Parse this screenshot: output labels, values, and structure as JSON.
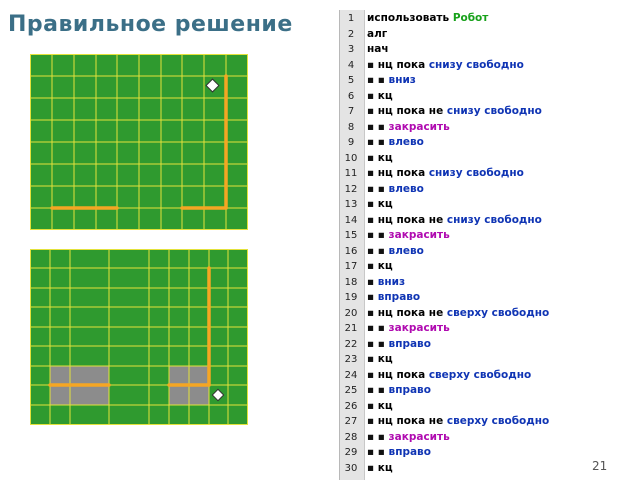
{
  "slide": {
    "title": "Правильное решение",
    "page_number": "21"
  },
  "colors": {
    "field_green": "#2f9a2f",
    "grid_yellow": "#e3e23b",
    "wall_orange": "#f5a623",
    "painted_gray": "#8c8c8c",
    "keyword_blue": "#0f34b4",
    "robot_green": "#17a11a",
    "paint_magenta": "#b00ab0"
  },
  "icons": {
    "robot": "diamond-robot-icon"
  },
  "code": {
    "lines": [
      {
        "n": "1",
        "parts": [
          {
            "t": "использовать ",
            "c": "t-kw"
          },
          {
            "t": "Робот",
            "c": "t-robot"
          }
        ]
      },
      {
        "n": "2",
        "parts": [
          {
            "t": "алг",
            "c": "t-kw"
          }
        ]
      },
      {
        "n": "3",
        "parts": [
          {
            "t": "нач",
            "c": "t-kw"
          }
        ]
      },
      {
        "n": "4",
        "parts": [
          {
            "t": "▪ ",
            "c": "bul"
          },
          {
            "t": "нц пока ",
            "c": "t-kw"
          },
          {
            "t": "снизу свободно",
            "c": "t-cmd"
          }
        ]
      },
      {
        "n": "5",
        "parts": [
          {
            "t": "▪ ▪ ",
            "c": "bul"
          },
          {
            "t": "вниз",
            "c": "t-cmd"
          }
        ]
      },
      {
        "n": "6",
        "parts": [
          {
            "t": "▪ ",
            "c": "bul"
          },
          {
            "t": "кц",
            "c": "t-kw"
          }
        ]
      },
      {
        "n": "7",
        "parts": [
          {
            "t": "▪ ",
            "c": "bul"
          },
          {
            "t": "нц пока не ",
            "c": "t-kw"
          },
          {
            "t": "снизу свободно",
            "c": "t-cmd"
          }
        ]
      },
      {
        "n": "8",
        "parts": [
          {
            "t": "▪ ▪ ",
            "c": "bul"
          },
          {
            "t": "закрасить",
            "c": "t-paint"
          }
        ]
      },
      {
        "n": "9",
        "parts": [
          {
            "t": "▪ ▪ ",
            "c": "bul"
          },
          {
            "t": "влево",
            "c": "t-cmd"
          }
        ]
      },
      {
        "n": "10",
        "parts": [
          {
            "t": "▪ ",
            "c": "bul"
          },
          {
            "t": "кц",
            "c": "t-kw"
          }
        ]
      },
      {
        "n": "11",
        "parts": [
          {
            "t": "▪ ",
            "c": "bul"
          },
          {
            "t": "нц пока ",
            "c": "t-kw"
          },
          {
            "t": "снизу свободно",
            "c": "t-cmd"
          }
        ]
      },
      {
        "n": "12",
        "parts": [
          {
            "t": "▪ ▪ ",
            "c": "bul"
          },
          {
            "t": "влево",
            "c": "t-cmd"
          }
        ]
      },
      {
        "n": "13",
        "parts": [
          {
            "t": "▪ ",
            "c": "bul"
          },
          {
            "t": "кц",
            "c": "t-kw"
          }
        ]
      },
      {
        "n": "14",
        "parts": [
          {
            "t": "▪ ",
            "c": "bul"
          },
          {
            "t": "нц пока не ",
            "c": "t-kw"
          },
          {
            "t": "снизу свободно",
            "c": "t-cmd"
          }
        ]
      },
      {
        "n": "15",
        "parts": [
          {
            "t": "▪ ▪ ",
            "c": "bul"
          },
          {
            "t": "закрасить",
            "c": "t-paint"
          }
        ]
      },
      {
        "n": "16",
        "parts": [
          {
            "t": "▪ ▪ ",
            "c": "bul"
          },
          {
            "t": "влево",
            "c": "t-cmd"
          }
        ]
      },
      {
        "n": "17",
        "parts": [
          {
            "t": "▪ ",
            "c": "bul"
          },
          {
            "t": "кц",
            "c": "t-kw"
          }
        ]
      },
      {
        "n": "18",
        "parts": [
          {
            "t": "▪ ",
            "c": "bul"
          },
          {
            "t": "вниз",
            "c": "t-cmd"
          }
        ]
      },
      {
        "n": "19",
        "parts": [
          {
            "t": "▪ ",
            "c": "bul"
          },
          {
            "t": "вправо",
            "c": "t-cmd"
          }
        ]
      },
      {
        "n": "20",
        "parts": [
          {
            "t": "▪ ",
            "c": "bul"
          },
          {
            "t": "нц пока не ",
            "c": "t-kw"
          },
          {
            "t": "сверху свободно",
            "c": "t-cmd"
          }
        ]
      },
      {
        "n": "21",
        "parts": [
          {
            "t": "▪ ▪ ",
            "c": "bul"
          },
          {
            "t": "закрасить",
            "c": "t-paint"
          }
        ]
      },
      {
        "n": "22",
        "parts": [
          {
            "t": "▪ ▪ ",
            "c": "bul"
          },
          {
            "t": "вправо",
            "c": "t-cmd"
          }
        ]
      },
      {
        "n": "23",
        "parts": [
          {
            "t": "▪ ",
            "c": "bul"
          },
          {
            "t": "кц",
            "c": "t-kw"
          }
        ]
      },
      {
        "n": "24",
        "parts": [
          {
            "t": "▪ ",
            "c": "bul"
          },
          {
            "t": "нц пока ",
            "c": "t-kw"
          },
          {
            "t": "сверху свободно",
            "c": "t-cmd"
          }
        ]
      },
      {
        "n": "25",
        "parts": [
          {
            "t": "▪ ▪ ",
            "c": "bul"
          },
          {
            "t": "вправо",
            "c": "t-cmd"
          }
        ]
      },
      {
        "n": "26",
        "parts": [
          {
            "t": "▪ ",
            "c": "bul"
          },
          {
            "t": "кц",
            "c": "t-kw"
          }
        ]
      },
      {
        "n": "27",
        "parts": [
          {
            "t": "▪ ",
            "c": "bul"
          },
          {
            "t": "нц пока не ",
            "c": "t-kw"
          },
          {
            "t": "сверху свободно",
            "c": "t-cmd"
          }
        ]
      },
      {
        "n": "28",
        "parts": [
          {
            "t": "▪ ▪ ",
            "c": "bul"
          },
          {
            "t": "закрасить",
            "c": "t-paint"
          }
        ]
      },
      {
        "n": "29",
        "parts": [
          {
            "t": "▪ ▪ ",
            "c": "bul"
          },
          {
            "t": "вправо",
            "c": "t-cmd"
          }
        ]
      },
      {
        "n": "30",
        "parts": [
          {
            "t": "▪ ",
            "c": "bul"
          },
          {
            "t": "кц",
            "c": "t-kw"
          }
        ]
      }
    ]
  }
}
